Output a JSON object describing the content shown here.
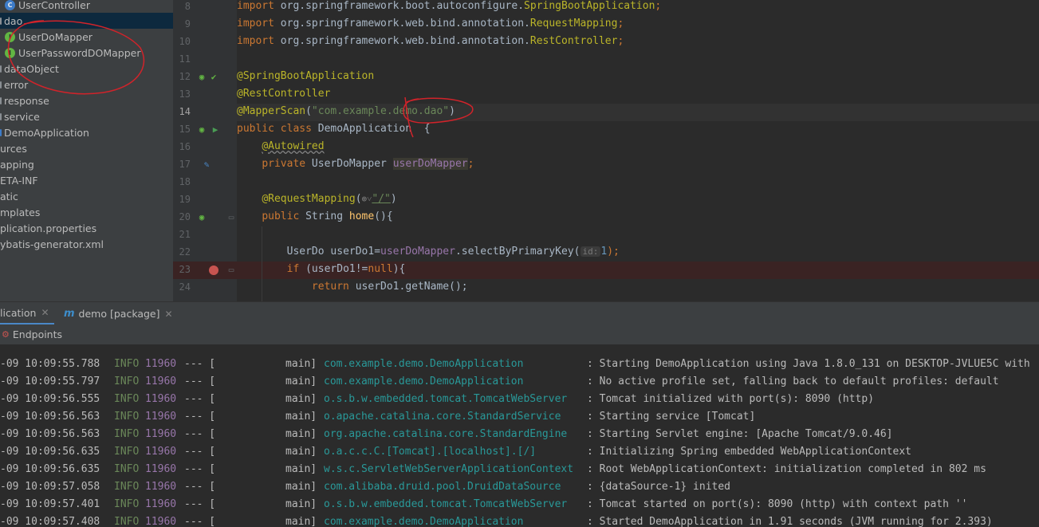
{
  "project_tree": {
    "items": [
      {
        "label": "UserController",
        "icon": "class-icon"
      },
      {
        "label": "dao",
        "icon": "folder-icon",
        "selected": true
      },
      {
        "label": "UserDoMapper",
        "icon": "interface-icon"
      },
      {
        "label": "UserPasswordDOMapper",
        "icon": "interface-icon"
      },
      {
        "label": "dataObject",
        "icon": "folder-icon"
      },
      {
        "label": "error",
        "icon": "folder-icon"
      },
      {
        "label": "response",
        "icon": "folder-icon"
      },
      {
        "label": "service",
        "icon": "folder-icon"
      },
      {
        "label": "DemoApplication",
        "icon": "spring-app-icon"
      },
      {
        "label": "urces",
        "icon": "none"
      },
      {
        "label": "apping",
        "icon": "none"
      },
      {
        "label": "ETA-INF",
        "icon": "none"
      },
      {
        "label": "atic",
        "icon": "none"
      },
      {
        "label": "mplates",
        "icon": "none"
      },
      {
        "label": "plication.properties",
        "icon": "none"
      },
      {
        "label": "ybatis-generator.xml",
        "icon": "none"
      }
    ]
  },
  "editor": {
    "line_numbers": [
      "8",
      "9",
      "10",
      "11",
      "12",
      "13",
      "14",
      "15",
      "16",
      "17",
      "18",
      "19",
      "20",
      "21",
      "22",
      "23",
      "24"
    ],
    "lines": {
      "l8_pkg": "org.springframework.boot.autoconfigure.",
      "l8_cls": "SpringBootApplication",
      "l9_pkg": "org.springframework.web.bind.annotation.",
      "l9_cls": "RequestMapping",
      "l10_pkg": "org.springframework.web.bind.annotation.",
      "l10_cls": "RestController",
      "import_kw": "import",
      "semicolon": ";",
      "l12": "@SpringBootApplication",
      "l13": "@RestController",
      "l14_ann": "@MapperScan",
      "l14_open": "(",
      "l14_str": "\"com.example.demo.dao\"",
      "l14_close": ")",
      "l15_kw": "public class",
      "l15_name": " DemoApplication  {",
      "l16": "@Autowired",
      "l17_kw": "private",
      "l17_type": " UserDoMapper ",
      "l17_field": "userDoMapper",
      "l19_ann": "@RequestMapping",
      "l19_open": "(",
      "l19_icon": "⊕˅",
      "l19_str": "\"/\"",
      "l19_close": ")",
      "l20_kw": "public",
      "l20_type": " String ",
      "l20_fn": "home",
      "l20_rest": "(){",
      "l22_a": "UserDo userDo1=",
      "l22_field": "userDoMapper",
      "l22_b": ".selectByPrimaryKey(",
      "l22_hint": "id:",
      "l22_num": "1",
      "l22_c": ");",
      "l23_kw": "if",
      "l23_a": " (userDo1!=",
      "l23_kw2": "null",
      "l23_b": "){",
      "l24_kw": "return",
      "l24_a": " userDo1.getName();"
    }
  },
  "run_panel": {
    "tabs": [
      {
        "label": "lication",
        "active": true
      },
      {
        "label": "demo [package]",
        "icon": "m"
      }
    ],
    "toolbar_label": "Endpoints",
    "log": [
      {
        "ts": "-09 10:09:55.788",
        "level": "INFO",
        "pid": "11960",
        "sep": "--- [",
        "thread": "main]",
        "logger": "com.example.demo.DemoApplication",
        "msg": ": Starting DemoApplication using Java 1.8.0_131 on DESKTOP-JVLUE5C with"
      },
      {
        "ts": "-09 10:09:55.797",
        "level": "INFO",
        "pid": "11960",
        "sep": "--- [",
        "thread": "main]",
        "logger": "com.example.demo.DemoApplication",
        "msg": ": No active profile set, falling back to default profiles: default"
      },
      {
        "ts": "-09 10:09:56.555",
        "level": "INFO",
        "pid": "11960",
        "sep": "--- [",
        "thread": "main]",
        "logger": "o.s.b.w.embedded.tomcat.TomcatWebServer",
        "msg": ": Tomcat initialized with port(s): 8090 (http)"
      },
      {
        "ts": "-09 10:09:56.563",
        "level": "INFO",
        "pid": "11960",
        "sep": "--- [",
        "thread": "main]",
        "logger": "o.apache.catalina.core.StandardService",
        "msg": ": Starting service [Tomcat]"
      },
      {
        "ts": "-09 10:09:56.563",
        "level": "INFO",
        "pid": "11960",
        "sep": "--- [",
        "thread": "main]",
        "logger": "org.apache.catalina.core.StandardEngine",
        "msg": ": Starting Servlet engine: [Apache Tomcat/9.0.46]"
      },
      {
        "ts": "-09 10:09:56.635",
        "level": "INFO",
        "pid": "11960",
        "sep": "--- [",
        "thread": "main]",
        "logger": "o.a.c.c.C.[Tomcat].[localhost].[/]",
        "msg": ": Initializing Spring embedded WebApplicationContext"
      },
      {
        "ts": "-09 10:09:56.635",
        "level": "INFO",
        "pid": "11960",
        "sep": "--- [",
        "thread": "main]",
        "logger": "w.s.c.ServletWebServerApplicationContext",
        "msg": ": Root WebApplicationContext: initialization completed in 802 ms"
      },
      {
        "ts": "-09 10:09:57.058",
        "level": "INFO",
        "pid": "11960",
        "sep": "--- [",
        "thread": "main]",
        "logger": "com.alibaba.druid.pool.DruidDataSource",
        "msg": ": {dataSource-1} inited"
      },
      {
        "ts": "-09 10:09:57.401",
        "level": "INFO",
        "pid": "11960",
        "sep": "--- [",
        "thread": "main]",
        "logger": "o.s.b.w.embedded.tomcat.TomcatWebServer",
        "msg": ": Tomcat started on port(s): 8090 (http) with context path ''"
      },
      {
        "ts": "-09 10:09:57.408",
        "level": "INFO",
        "pid": "11960",
        "sep": "--- [",
        "thread": "main]",
        "logger": "com.example.demo.DemoApplication",
        "msg": ": Started DemoApplication in 1.91 seconds (JVM running for 2.393)"
      }
    ]
  },
  "colors": {
    "annotation_stroke": "#d1232a",
    "tree_bg": "#3c3f41",
    "editor_bg": "#2b2b2b",
    "selection": "#0d293e"
  }
}
